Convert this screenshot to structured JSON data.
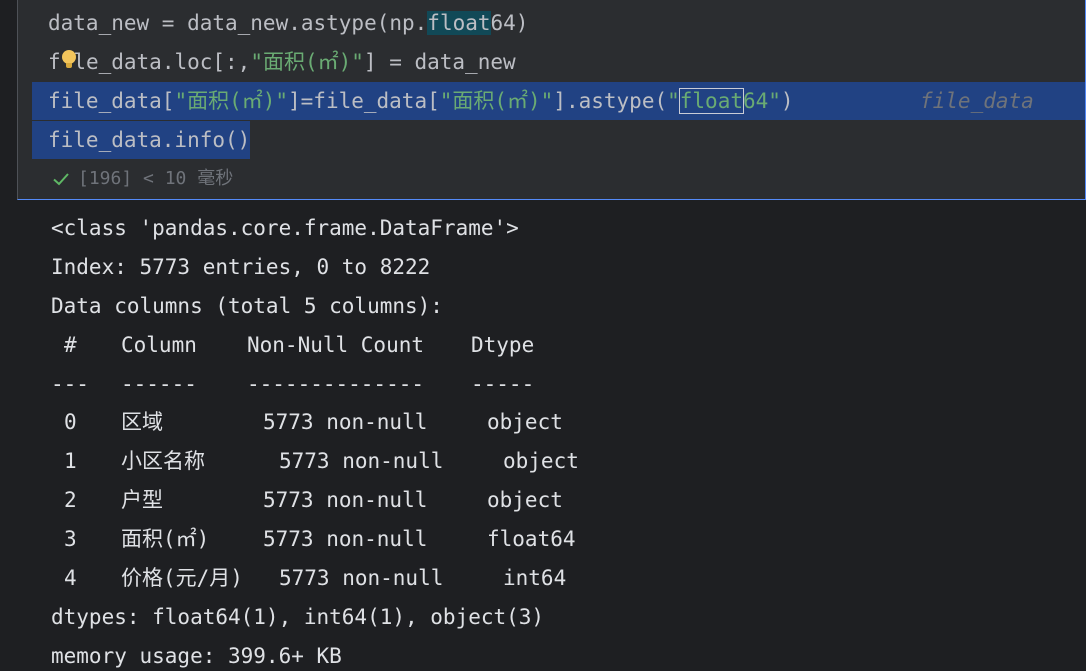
{
  "code": {
    "line1": {
      "prefix": "data_new = data_new.astype(np.",
      "highlight": "float",
      "suffix": "64)"
    },
    "line2": {
      "a": "f",
      "b": "le_data.loc[:,",
      "str": "\"面积(㎡)\"",
      "c": "] = data_new"
    },
    "line3": {
      "a": "file_data[",
      "str1": "\"面积(㎡)\"",
      "b": "]=file_data[",
      "str2": "\"面积(㎡)\"",
      "c": "].astype(",
      "q1": "\"",
      "boxed": "float",
      "str3": "64\"",
      "d": ")"
    },
    "line4": "file_data.info()",
    "inlay_hint": "file_data"
  },
  "status": {
    "text": "[196] < 10 毫秒"
  },
  "output": {
    "header_lines": [
      "<class 'pandas.core.frame.DataFrame'>",
      "Index: 5773 entries, 0 to 8222",
      "Data columns (total 5 columns):"
    ],
    "columns_header": {
      "num": "#",
      "column": "Column",
      "count": "Non-Null Count",
      "dtype": "Dtype"
    },
    "separator": {
      "num": "---",
      "column": "------",
      "count": "--------------",
      "dtype": "-----"
    },
    "rows": [
      {
        "num": "0",
        "column": "区域",
        "count": "5773 non-null",
        "dtype": "object"
      },
      {
        "num": "1",
        "column": "小区名称",
        "count": "5773 non-null",
        "dtype": "object"
      },
      {
        "num": "2",
        "column": "户型",
        "count": "5773 non-null",
        "dtype": "object"
      },
      {
        "num": "3",
        "column": "面积(㎡)",
        "count": "5773 non-null",
        "dtype": "float64"
      },
      {
        "num": "4",
        "column": "价格(元/月)",
        "count": "5773 non-null",
        "dtype": "int64"
      }
    ],
    "footer_lines": [
      "dtypes: float64(1), int64(1), object(3)",
      "memory usage: 399.6+ KB"
    ]
  },
  "colors": {
    "background": "#1e1f22",
    "cell_background": "#2b2d30",
    "selection": "#214283",
    "string": "#6aab73",
    "accent_border": "#548af7"
  }
}
